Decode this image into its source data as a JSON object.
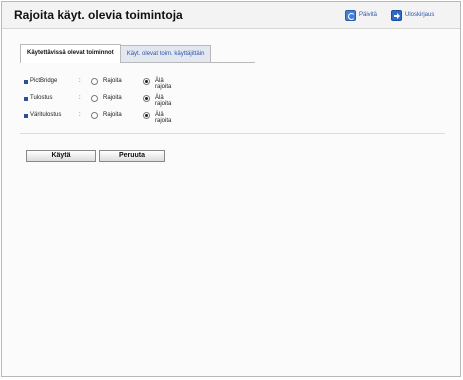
{
  "header": {
    "title": "Rajoita käyt. olevia toimintoja",
    "refresh_label": "Päivitä",
    "logout_label": "Uloskirjaus"
  },
  "tabs": [
    {
      "label": "Käytettävissä olevat toiminnot",
      "active": true
    },
    {
      "label": "Käyt. olevat toim. käyttäjittäin",
      "active": false
    }
  ],
  "settings": [
    {
      "label": "PictBridge",
      "option_restrict": "Rajoita",
      "option_no_restrict": "Älä rajoita",
      "selected": "Älä rajoita"
    },
    {
      "label": "Tulostus",
      "option_restrict": "Rajoita",
      "option_no_restrict": "Älä rajoita",
      "selected": "Älä rajoita"
    },
    {
      "label": "Väritulostus",
      "option_restrict": "Rajoita",
      "option_no_restrict": "Älä rajoita",
      "selected": "Älä rajoita"
    }
  ],
  "separator": ":",
  "buttons": {
    "apply_label": "Käytä",
    "cancel_label": "Peruuta"
  },
  "colors": {
    "link": "#2f57a8",
    "bullet": "#2d4f96",
    "header_bg": "#f3f3f3"
  }
}
